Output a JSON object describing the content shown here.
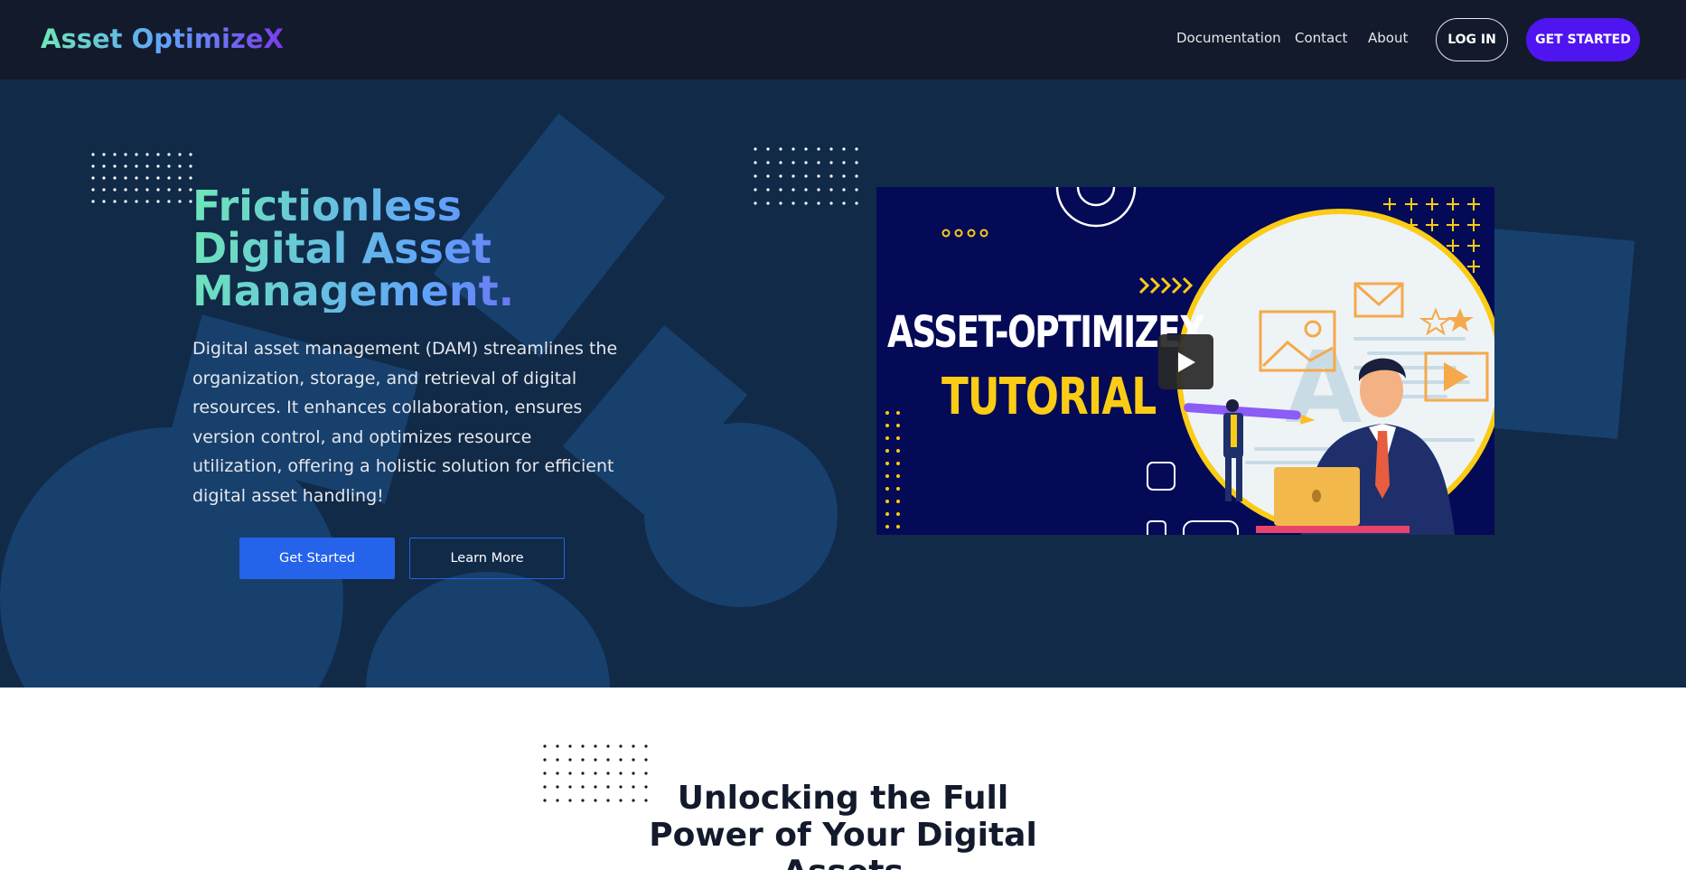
{
  "nav": {
    "logo": "Asset OptimizeX",
    "links": [
      "Documentation",
      "Contact",
      "About"
    ],
    "login": "LOG IN",
    "get_started": "GET STARTED"
  },
  "hero": {
    "title": "Frictionless Digital Asset Management.",
    "description": "Digital asset management (DAM) streamlines the organization, storage, and retrieval of digital resources. It enhances collaboration, ensures version control, and optimizes resource utilization, offering a holistic solution for efficient digital asset handling!",
    "primary_button": "Get Started",
    "secondary_button": "Learn More"
  },
  "video": {
    "title_line1": "ASSET-OPTIMIZEX",
    "title_line2": "TUTORIAL"
  },
  "section2": {
    "title": "Unlocking the Full Power of Your Digital Assets"
  },
  "colors": {
    "nav_bg": "#131a2b",
    "hero_bg": "#112a48",
    "accent_purple": "#4f15f0",
    "accent_blue": "#2563eb",
    "video_bg": "#050a57",
    "video_yellow": "#facc15"
  },
  "icons": [
    "play-icon",
    "envelope-icon",
    "picture-icon",
    "star-icon",
    "pencil-icon",
    "laptop-icon"
  ]
}
